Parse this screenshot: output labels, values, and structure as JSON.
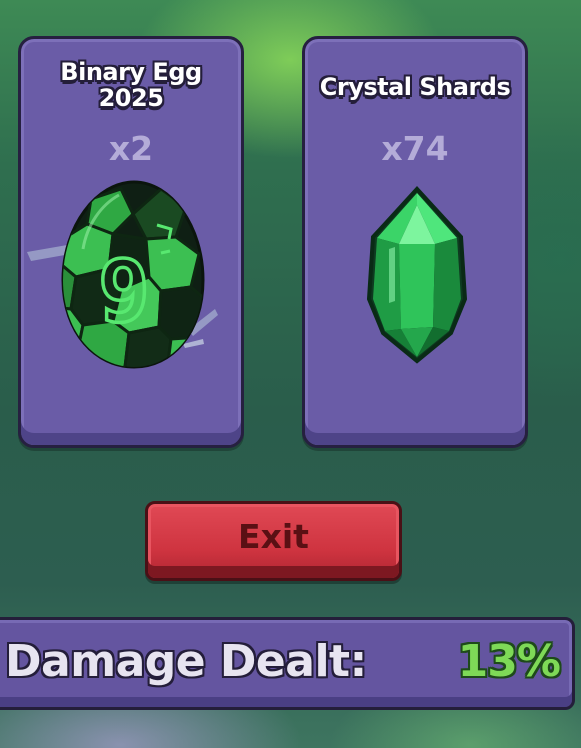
{
  "rewards": [
    {
      "title_line1": "Binary Egg",
      "title_line2": "2025",
      "quantity": "x2",
      "icon": "binary-egg-icon"
    },
    {
      "title": "Crystal Shards",
      "quantity": "x74",
      "icon": "crystal-shard-icon"
    }
  ],
  "egg_display_digit": "9",
  "exit_button": {
    "label": "Exit",
    "color": "#d63a46"
  },
  "damage": {
    "label": "Damage Dealt:",
    "value": "13%",
    "value_color": "#7ed957"
  },
  "colors": {
    "card_fill": "#6a5ca7",
    "card_border": "#262040",
    "quantity_text": "#b4acd8",
    "egg_green": "#35b04a",
    "crystal_green": "#2fc45a"
  }
}
